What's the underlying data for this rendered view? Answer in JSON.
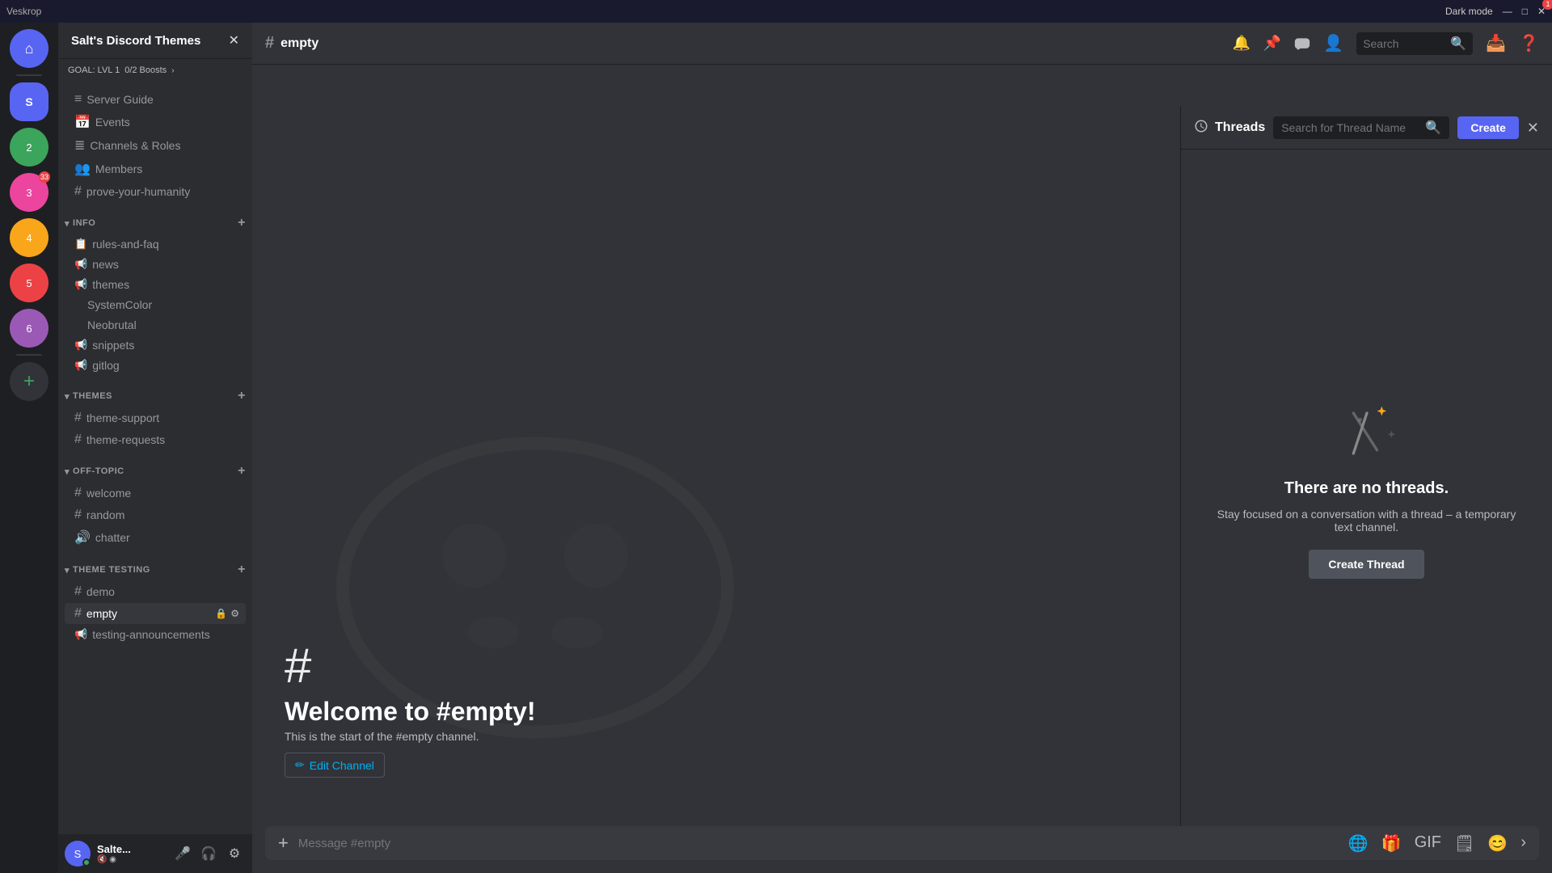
{
  "taskbar": {
    "left_label": "Veskrop",
    "dark_mode": "Dark mode",
    "minimize": "—",
    "maximize": "□",
    "close": "✕"
  },
  "server": {
    "name": "Salt's Discord Themes",
    "dropdown_icon": "▾",
    "boost_goal": "GOAL: LVL 1",
    "boost_count": "0/2 Boosts",
    "boost_chevron": "›"
  },
  "server_list": {
    "icons": [
      {
        "id": "discord-home",
        "label": "Home",
        "symbol": "⌂",
        "color": "#5865f2"
      },
      {
        "id": "server-1",
        "label": "Salt's Discord Themes",
        "symbol": "S",
        "color": "#5865f2"
      },
      {
        "id": "server-2",
        "label": "Server 2",
        "symbol": "2",
        "color": "#3ba55c"
      },
      {
        "id": "server-3",
        "label": "Server 3",
        "symbol": "3",
        "color": "#eb459e"
      },
      {
        "id": "server-4",
        "label": "Server 4",
        "symbol": "4",
        "color": "#faa61a"
      },
      {
        "id": "server-5",
        "label": "Server 5",
        "symbol": "5",
        "color": "#ed4245"
      },
      {
        "id": "server-6",
        "label": "Server 6",
        "symbol": "6",
        "color": "#9b59b6"
      },
      {
        "id": "add-server",
        "label": "Add a Server",
        "symbol": "+"
      }
    ]
  },
  "sidebar": {
    "special_items": [
      {
        "id": "server-guide",
        "label": "Server Guide",
        "icon": "≡"
      },
      {
        "id": "events",
        "label": "Events",
        "icon": "📅"
      },
      {
        "id": "channels-roles",
        "label": "Channels & Roles",
        "icon": "≣"
      },
      {
        "id": "members",
        "label": "Members",
        "icon": "👥"
      }
    ],
    "channels_no_category": [
      {
        "id": "prove-your-humanity",
        "label": "prove-your-humanity",
        "icon": "#"
      }
    ],
    "categories": [
      {
        "id": "info",
        "label": "INFO",
        "channels": [
          {
            "id": "rules-and-faq",
            "label": "rules-and-faq",
            "icon": "📋"
          },
          {
            "id": "news",
            "label": "news",
            "icon": "📢"
          },
          {
            "id": "themes",
            "label": "themes",
            "icon": "📢",
            "subchannels": [
              {
                "id": "systemcolor",
                "label": "SystemColor"
              },
              {
                "id": "neobrutal",
                "label": "Neobrutal"
              }
            ]
          },
          {
            "id": "snippets",
            "label": "snippets",
            "icon": "📢"
          },
          {
            "id": "gitlog",
            "label": "gitlog",
            "icon": "📢"
          }
        ]
      },
      {
        "id": "themes",
        "label": "THEMES",
        "channels": [
          {
            "id": "theme-support",
            "label": "theme-support",
            "icon": "#"
          },
          {
            "id": "theme-requests",
            "label": "theme-requests",
            "icon": "#"
          }
        ]
      },
      {
        "id": "off-topic",
        "label": "OFF-TOPIC",
        "channels": [
          {
            "id": "welcome",
            "label": "welcome",
            "icon": "#"
          },
          {
            "id": "random",
            "label": "random",
            "icon": "#"
          },
          {
            "id": "chatter",
            "label": "chatter",
            "icon": "🔊"
          }
        ]
      },
      {
        "id": "theme-testing",
        "label": "THEME TESTING",
        "channels": [
          {
            "id": "demo",
            "label": "demo",
            "icon": "#"
          },
          {
            "id": "empty",
            "label": "empty",
            "icon": "#",
            "active": true
          },
          {
            "id": "testing-announcements",
            "label": "testing-announcements",
            "icon": "📢"
          }
        ]
      }
    ]
  },
  "channel_header": {
    "hash": "#",
    "name": "empty",
    "icons": [
      "🔔",
      "📌",
      "👤",
      "🔍"
    ],
    "search_placeholder": "Search"
  },
  "channel_welcome": {
    "hash_symbol": "#",
    "title": "Welcome to #empty!",
    "description": "This is the start of the #empty channel.",
    "edit_label": "Edit Channel",
    "edit_icon": "✏"
  },
  "message_input": {
    "placeholder": "Message #empty",
    "add_icon": "+"
  },
  "threads_panel": {
    "title": "Threads",
    "search_placeholder": "Search for Thread Name",
    "create_label": "Create",
    "close_icon": "✕",
    "empty_title": "There are no threads.",
    "empty_description": "Stay focused on a conversation with a thread – a temporary text channel.",
    "create_thread_label": "Create Thread"
  },
  "user_area": {
    "name": "Salte...",
    "status": "◉ 🔇",
    "avatar_text": "S",
    "mic_icon": "🎤",
    "headphones_icon": "🎧",
    "settings_icon": "⚙"
  }
}
